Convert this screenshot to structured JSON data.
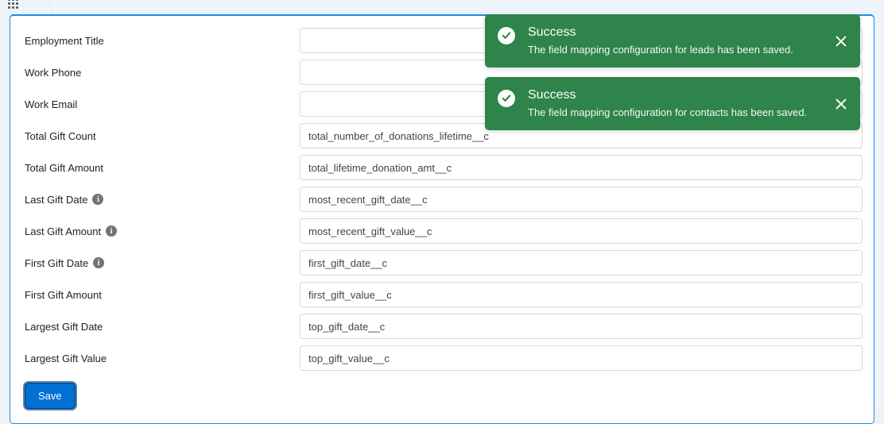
{
  "rows": [
    {
      "label": "Employment Title",
      "info": false,
      "value": ""
    },
    {
      "label": "Work Phone",
      "info": false,
      "value": ""
    },
    {
      "label": "Work Email",
      "info": false,
      "value": ""
    },
    {
      "label": "Total Gift Count",
      "info": false,
      "value": "total_number_of_donations_lifetime__c"
    },
    {
      "label": "Total Gift Amount",
      "info": false,
      "value": "total_lifetime_donation_amt__c"
    },
    {
      "label": "Last Gift Date",
      "info": true,
      "value": "most_recent_gift_date__c"
    },
    {
      "label": "Last Gift Amount",
      "info": true,
      "value": "most_recent_gift_value__c"
    },
    {
      "label": "First Gift Date",
      "info": true,
      "value": "first_gift_date__c"
    },
    {
      "label": "First Gift Amount",
      "info": false,
      "value": "first_gift_value__c"
    },
    {
      "label": "Largest Gift Date",
      "info": false,
      "value": "top_gift_date__c"
    },
    {
      "label": "Largest Gift Value",
      "info": false,
      "value": "top_gift_value__c"
    }
  ],
  "save_label": "Save",
  "toasts": [
    {
      "title": "Success",
      "msg": "The field mapping configuration for leads has been saved."
    },
    {
      "title": "Success",
      "msg": "The field mapping configuration for contacts has been saved."
    }
  ]
}
